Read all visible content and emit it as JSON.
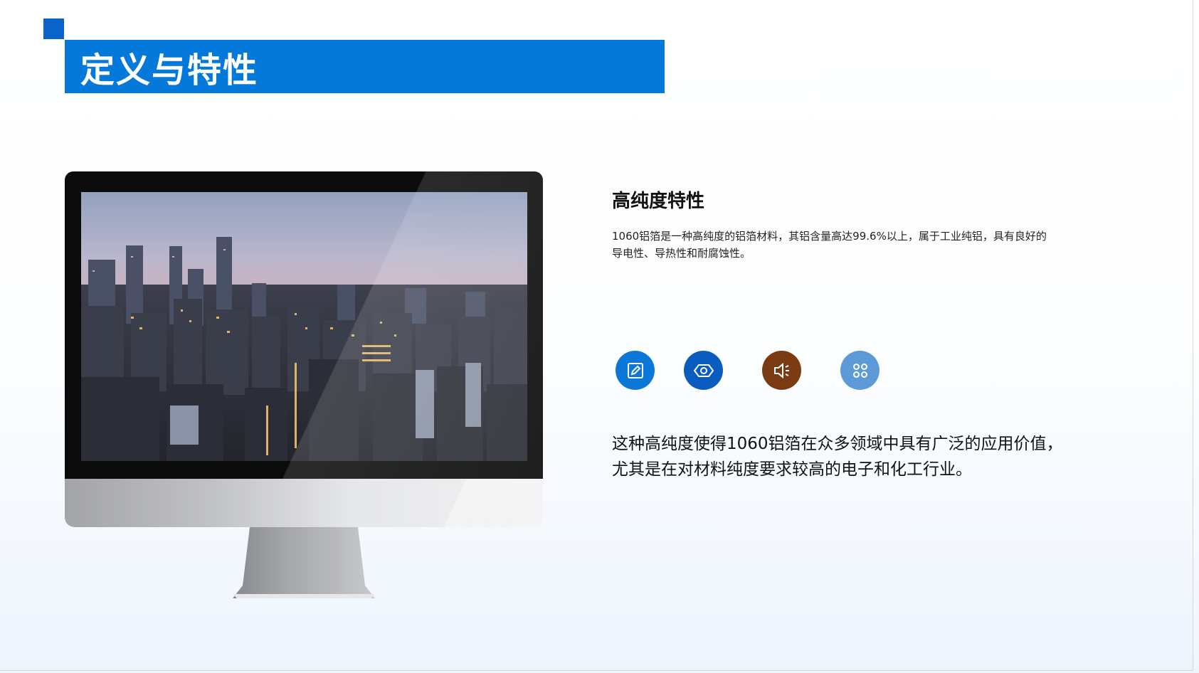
{
  "header": {
    "title": "定义与特性"
  },
  "colors": {
    "accent_square": "#0a63c9",
    "title_bar": "#0479d9",
    "icon_1": "#0b78d8",
    "icon_2": "#0a5dbf",
    "icon_3": "#7a3a12",
    "icon_4": "#5c9ad8"
  },
  "monitor": {
    "image_subject": "city-skyline-night-photo"
  },
  "content": {
    "subtitle": "高纯度特性",
    "paragraph_small": "1060铝箔是一种高纯度的铝箔材料，其铝含量高达99.6%以上，属于工业纯铝，具有良好的导电性、导热性和耐腐蚀性。",
    "icons": [
      "edit-icon",
      "hexagon-nut-icon",
      "speaker-icon",
      "grid-four-icon"
    ],
    "paragraph_large": "这种高纯度使得1060铝箔在众多领域中具有广泛的应用价值，尤其是在对材料纯度要求较高的电子和化工行业。"
  }
}
